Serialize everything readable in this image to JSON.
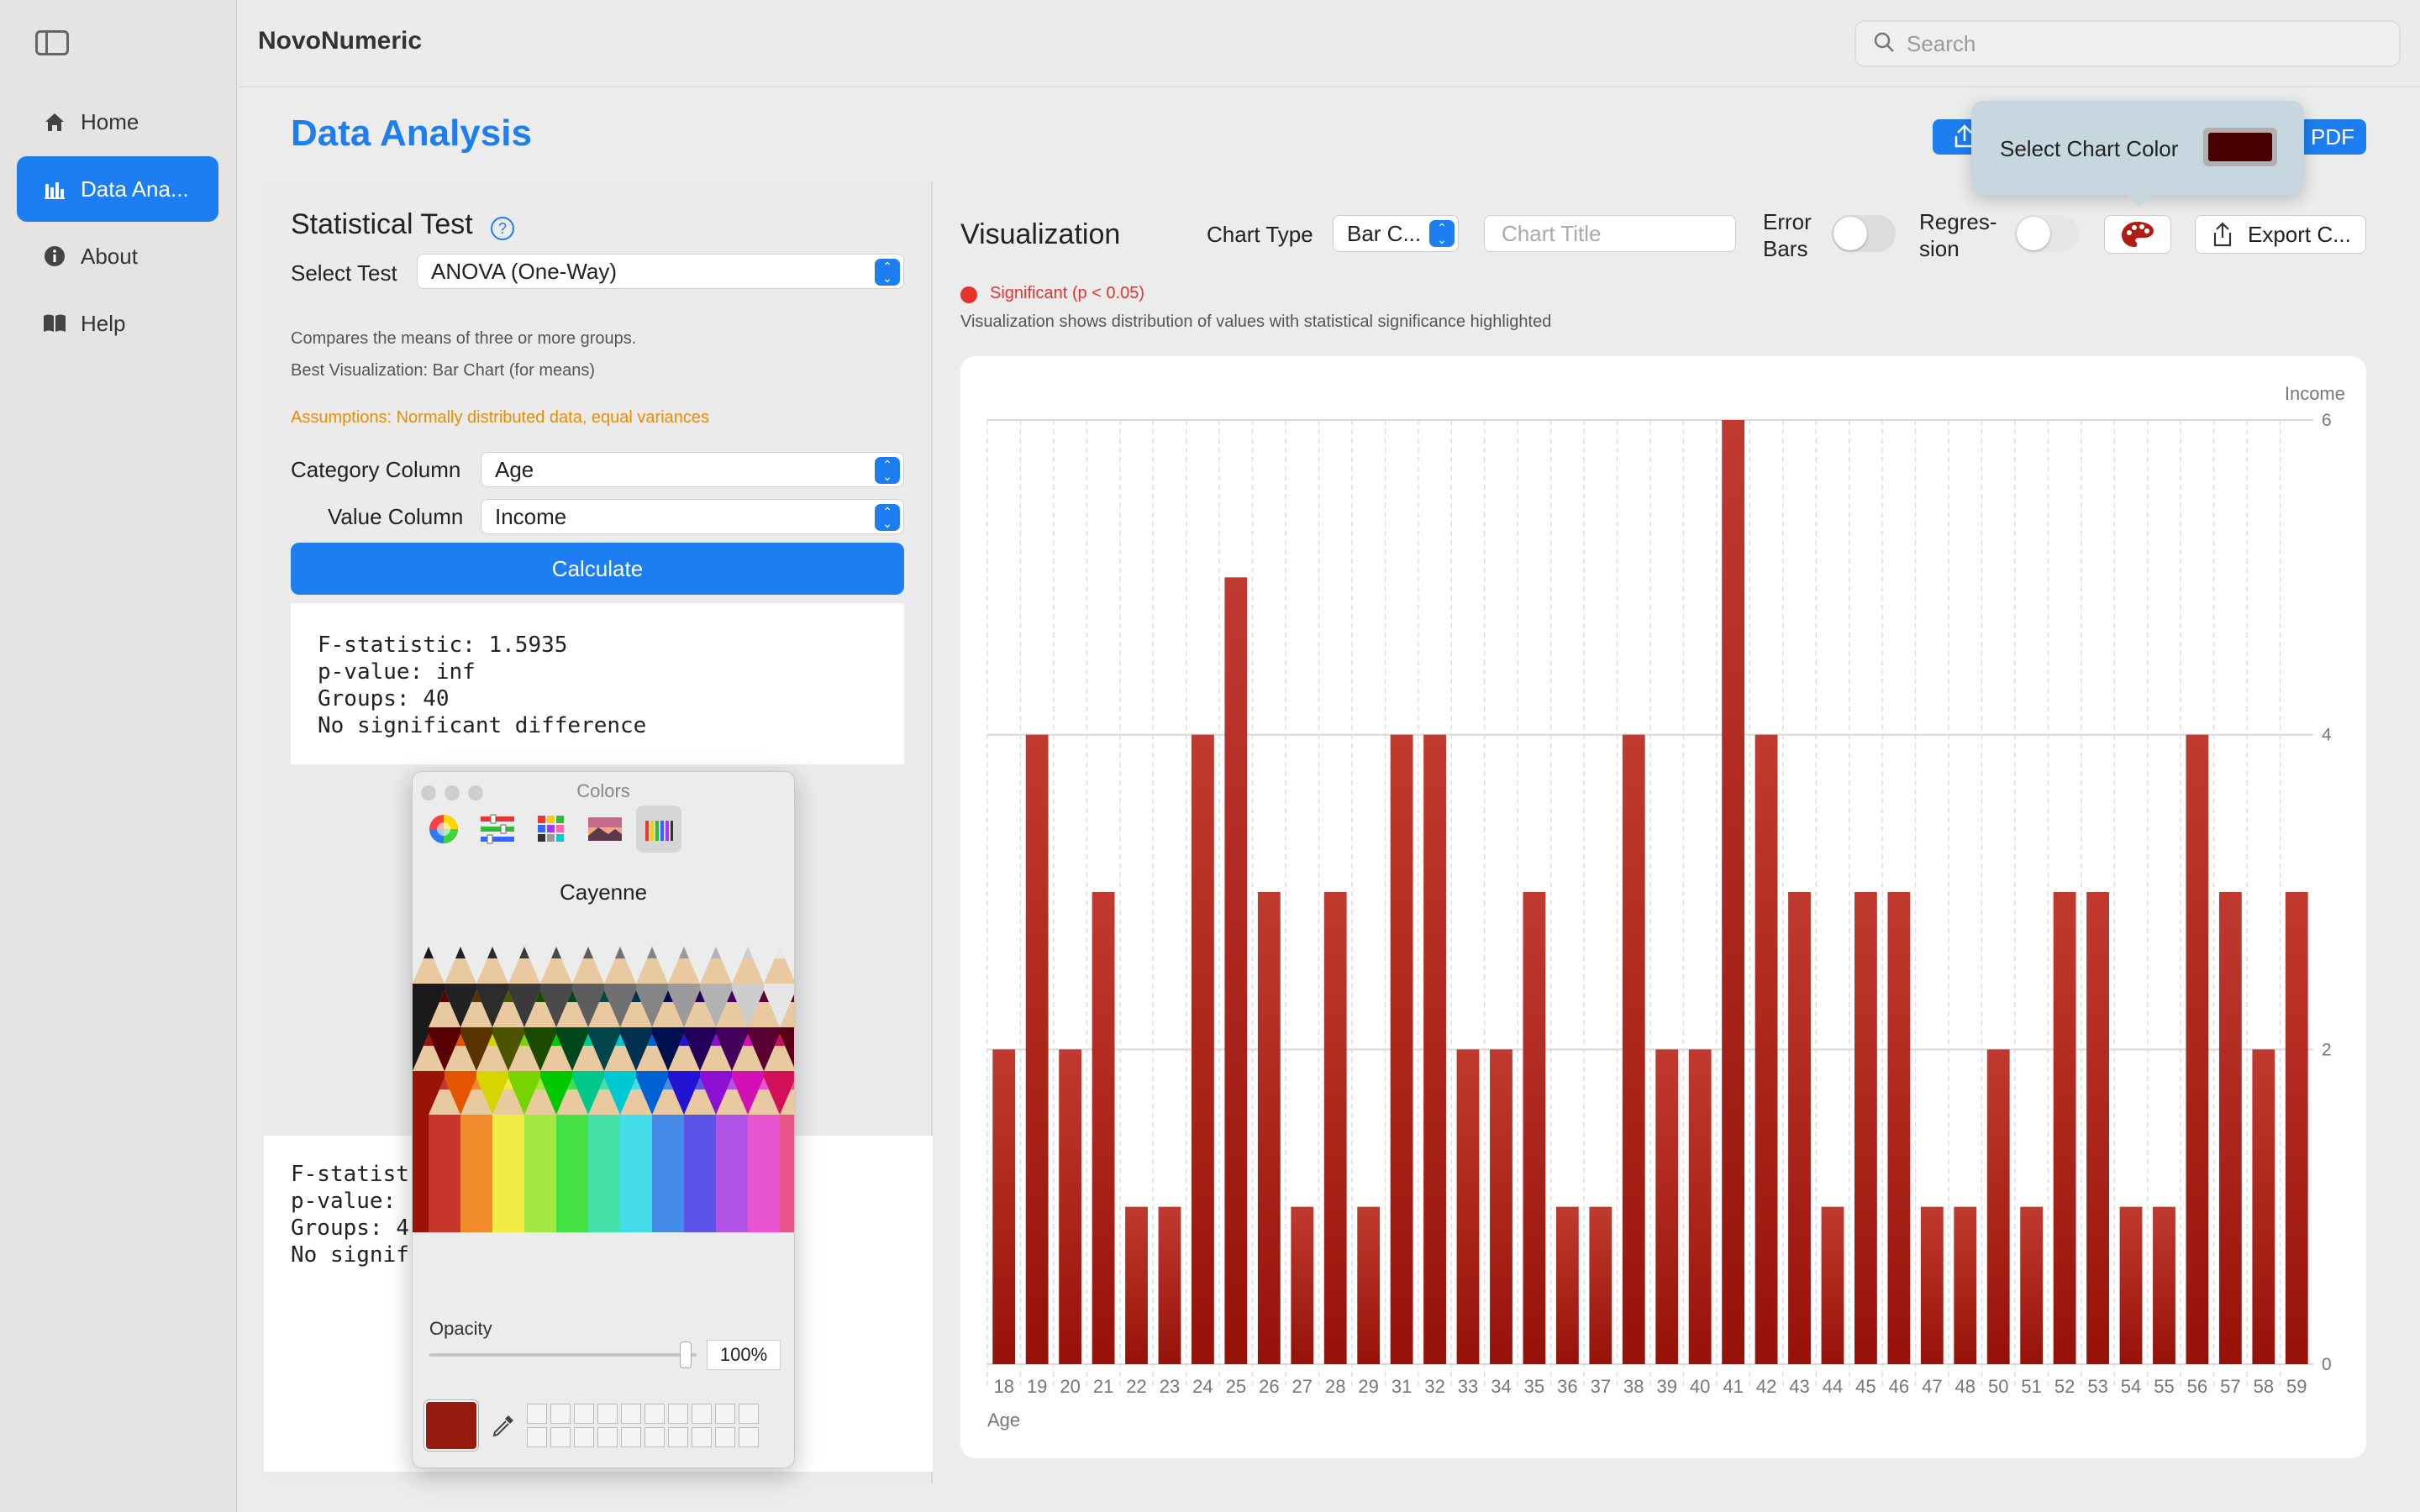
{
  "app": {
    "title": "NovoNumeric"
  },
  "search": {
    "placeholder": "Search"
  },
  "sidebar": {
    "items": [
      {
        "label": "Home",
        "icon": "house-icon"
      },
      {
        "label": "Data Ana...",
        "icon": "chart-bar-icon"
      },
      {
        "label": "About",
        "icon": "info-icon"
      },
      {
        "label": "Help",
        "icon": "book-icon"
      }
    ]
  },
  "main": {
    "page_title": "Data Analysis",
    "pdf_label": "PDF"
  },
  "stat": {
    "title": "Statistical Test",
    "select_test_label": "Select Test",
    "select_test_value": "ANOVA (One-Way)",
    "desc1": "Compares the means of three or more groups.",
    "desc2": "Best Visualization: Bar Chart (for means)",
    "assumptions": "Assumptions: Normally distributed data, equal variances",
    "category_label": "Category Column",
    "category_value": "Age",
    "value_label": "Value Column",
    "value_value": "Income",
    "calculate_label": "Calculate",
    "result_lines": [
      "F-statistic: 1.5935",
      "p-value: inf",
      "Groups: 40",
      "No significant difference"
    ],
    "result2_lines": [
      "F-statist",
      "p-value:",
      "Groups: 4",
      "No signif"
    ]
  },
  "colors_panel": {
    "title": "Colors",
    "color_name": "Cayenne",
    "opacity_label": "Opacity",
    "opacity_value": "100%",
    "selected_color": "#971a0f"
  },
  "viz": {
    "title": "Visualization",
    "chart_type_label": "Chart Type",
    "chart_type_value": "Bar C...",
    "chart_title_placeholder": "Chart Title",
    "error_bars_label": [
      "Error",
      "Bars"
    ],
    "regression_label": [
      "Regres-",
      "sion"
    ],
    "export_label": "Export C...",
    "significant_label": "Significant (p < 0.05)",
    "description": "Visualization shows distribution of values with statistical significance highlighted"
  },
  "popover": {
    "label": "Select Chart Color",
    "color": "#4a0000"
  },
  "chart_data": {
    "type": "bar",
    "xlabel": "Age",
    "ylabel": "Income",
    "ylim": [
      0,
      6
    ],
    "yticks": [
      0,
      2,
      4,
      6
    ],
    "grid": true,
    "bar_color": "#b8291d",
    "categories": [
      "18",
      "19",
      "20",
      "21",
      "22",
      "23",
      "24",
      "25",
      "26",
      "27",
      "28",
      "29",
      "31",
      "32",
      "33",
      "34",
      "35",
      "36",
      "37",
      "38",
      "39",
      "40",
      "41",
      "42",
      "43",
      "44",
      "45",
      "46",
      "47",
      "48",
      "50",
      "51",
      "52",
      "53",
      "54",
      "55",
      "56",
      "57",
      "58",
      "59"
    ],
    "values": [
      2,
      4,
      2,
      3,
      1,
      1,
      4,
      5,
      3,
      1,
      3,
      1,
      4,
      4,
      2,
      2,
      3,
      1,
      1,
      4,
      2,
      2,
      6,
      4,
      3,
      1,
      3,
      3,
      1,
      1,
      2,
      1,
      3,
      3,
      1,
      1,
      4,
      3,
      2,
      3
    ]
  }
}
